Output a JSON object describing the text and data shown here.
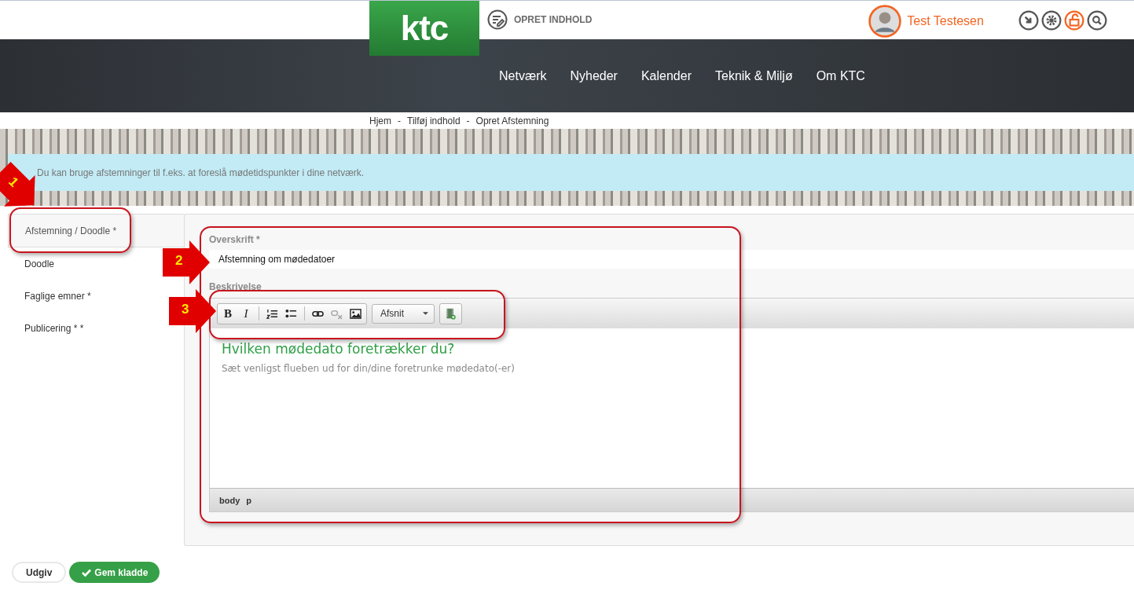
{
  "header": {
    "logo": "ktc",
    "create_link": "OPRET INDHOLD",
    "user_name": "Test Testesen"
  },
  "nav": [
    "Netværk",
    "Nyheder",
    "Kalender",
    "Teknik & Miljø",
    "Om KTC"
  ],
  "breadcrumb": {
    "separator": "-",
    "items": [
      "Hjem",
      "Tilføj indhold",
      "Opret Afstemning"
    ]
  },
  "info": "Du kan bruge afstemninger til f.eks. at foreslå mødetidspunkter i dine netværk.",
  "tabs": [
    {
      "label": "Afstemning / Doodle *",
      "selected": true
    },
    {
      "label": "Doodle",
      "selected": false
    },
    {
      "label": "Faglige emner *",
      "selected": false
    },
    {
      "label": "Publicering * *",
      "selected": false
    }
  ],
  "form": {
    "title_label": "Overskrift *",
    "title_value": "Afstemning om mødedatoer",
    "description_label": "Beskrivelse",
    "toolbar": [
      {
        "kind": "bold",
        "label": "B",
        "disabled": false
      },
      {
        "kind": "italic",
        "label": "I",
        "disabled": false
      },
      {
        "kind": "separator"
      },
      {
        "kind": "numbered-list",
        "disabled": false
      },
      {
        "kind": "bullet-list",
        "disabled": false
      },
      {
        "kind": "separator"
      },
      {
        "kind": "link",
        "disabled": false
      },
      {
        "kind": "unlink",
        "disabled": true
      },
      {
        "kind": "image",
        "disabled": false
      }
    ],
    "format_select": "Afsnit",
    "heading": "Hvilken mødedato foretrækker du?",
    "body": "Sæt venligst flueben ud for din/dine foretrunke mødedato(-er)",
    "path": [
      "body",
      "p"
    ]
  },
  "buttons": [
    {
      "label": "Udgiv",
      "kind": "secondary"
    },
    {
      "label": "Gem kladde",
      "kind": "primary"
    }
  ],
  "annotations": [
    {
      "number": "1"
    },
    {
      "number": "2"
    },
    {
      "number": "3"
    }
  ]
}
